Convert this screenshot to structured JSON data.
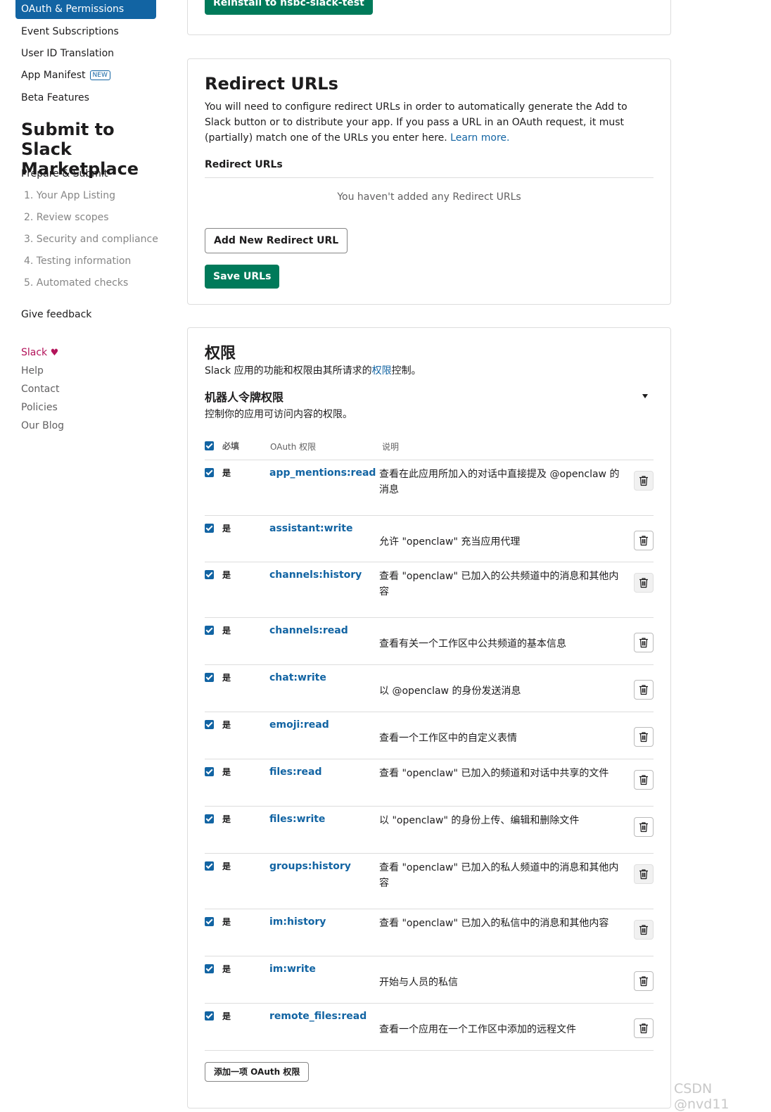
{
  "sidebar": {
    "active_item": "OAuth & Permissions",
    "items": [
      "Event Subscriptions",
      "User ID Translation",
      "App Manifest",
      "Beta Features"
    ],
    "new_badge": "NEW",
    "section_title": "Submit to Slack Marketplace",
    "prepare_label": "Prepare & Submit",
    "steps": [
      "1. Your App Listing",
      "2. Review scopes",
      "3. Security and compliance",
      "4. Testing information",
      "5. Automated checks"
    ],
    "feedback": "Give feedback",
    "footer": {
      "slack": "Slack",
      "heart": "♥",
      "help": "Help",
      "contact": "Contact",
      "policies": "Policies",
      "blog": "Our Blog"
    }
  },
  "install_card": {
    "reinstall_button": "Reinstall to hsbc-slack-test"
  },
  "redirect_card": {
    "title": "Redirect URLs",
    "description": "You will need to configure redirect URLs in order to automatically generate the Add to Slack button or to distribute your app. If you pass a URL in an OAuth request, it must (partially) match one of the URLs you enter here.",
    "learn_more": "Learn more.",
    "subheading": "Redirect URLs",
    "empty_text": "You haven't added any Redirect URLs",
    "add_button": "Add New Redirect URL",
    "save_button": "Save URLs"
  },
  "scopes_card": {
    "title": "权限",
    "description_prefix": "Slack 应用的功能和权限由其所请求的",
    "description_link": "权限",
    "description_suffix": "控制。",
    "bot_title": "机器人令牌权限",
    "bot_description": "控制你的应用可访问内容的权限。",
    "col_required": "必填",
    "col_scope": "OAuth 权限",
    "col_desc": "说明",
    "required_yes": "是",
    "scopes": [
      {
        "name": "app_mentions:read",
        "desc": "查看在此应用所加入的对话中直接提及 @openclaw 的消息"
      },
      {
        "name": "assistant:write",
        "desc": "允许 \"openclaw\" 充当应用代理"
      },
      {
        "name": "channels:history",
        "desc": "查看 \"openclaw\" 已加入的公共频道中的消息和其他内容"
      },
      {
        "name": "channels:read",
        "desc": "查看有关一个工作区中公共频道的基本信息"
      },
      {
        "name": "chat:write",
        "desc": "以 @openclaw 的身份发送消息"
      },
      {
        "name": "emoji:read",
        "desc": "查看一个工作区中的自定义表情"
      },
      {
        "name": "files:read",
        "desc": "查看 \"openclaw\" 已加入的频道和对话中共享的文件"
      },
      {
        "name": "files:write",
        "desc": "以 \"openclaw\" 的身份上传、编辑和删除文件"
      },
      {
        "name": "groups:history",
        "desc": "查看 \"openclaw\" 已加入的私人频道中的消息和其他内容"
      },
      {
        "name": "im:history",
        "desc": "查看 \"openclaw\" 已加入的私信中的消息和其他内容"
      },
      {
        "name": "im:write",
        "desc": "开始与人员的私信"
      },
      {
        "name": "remote_files:read",
        "desc": "查看一个应用在一个工作区中添加的远程文件"
      }
    ],
    "add_scope_button": "添加一项 OAuth 权限"
  },
  "watermark": "CSDN @nvd11"
}
